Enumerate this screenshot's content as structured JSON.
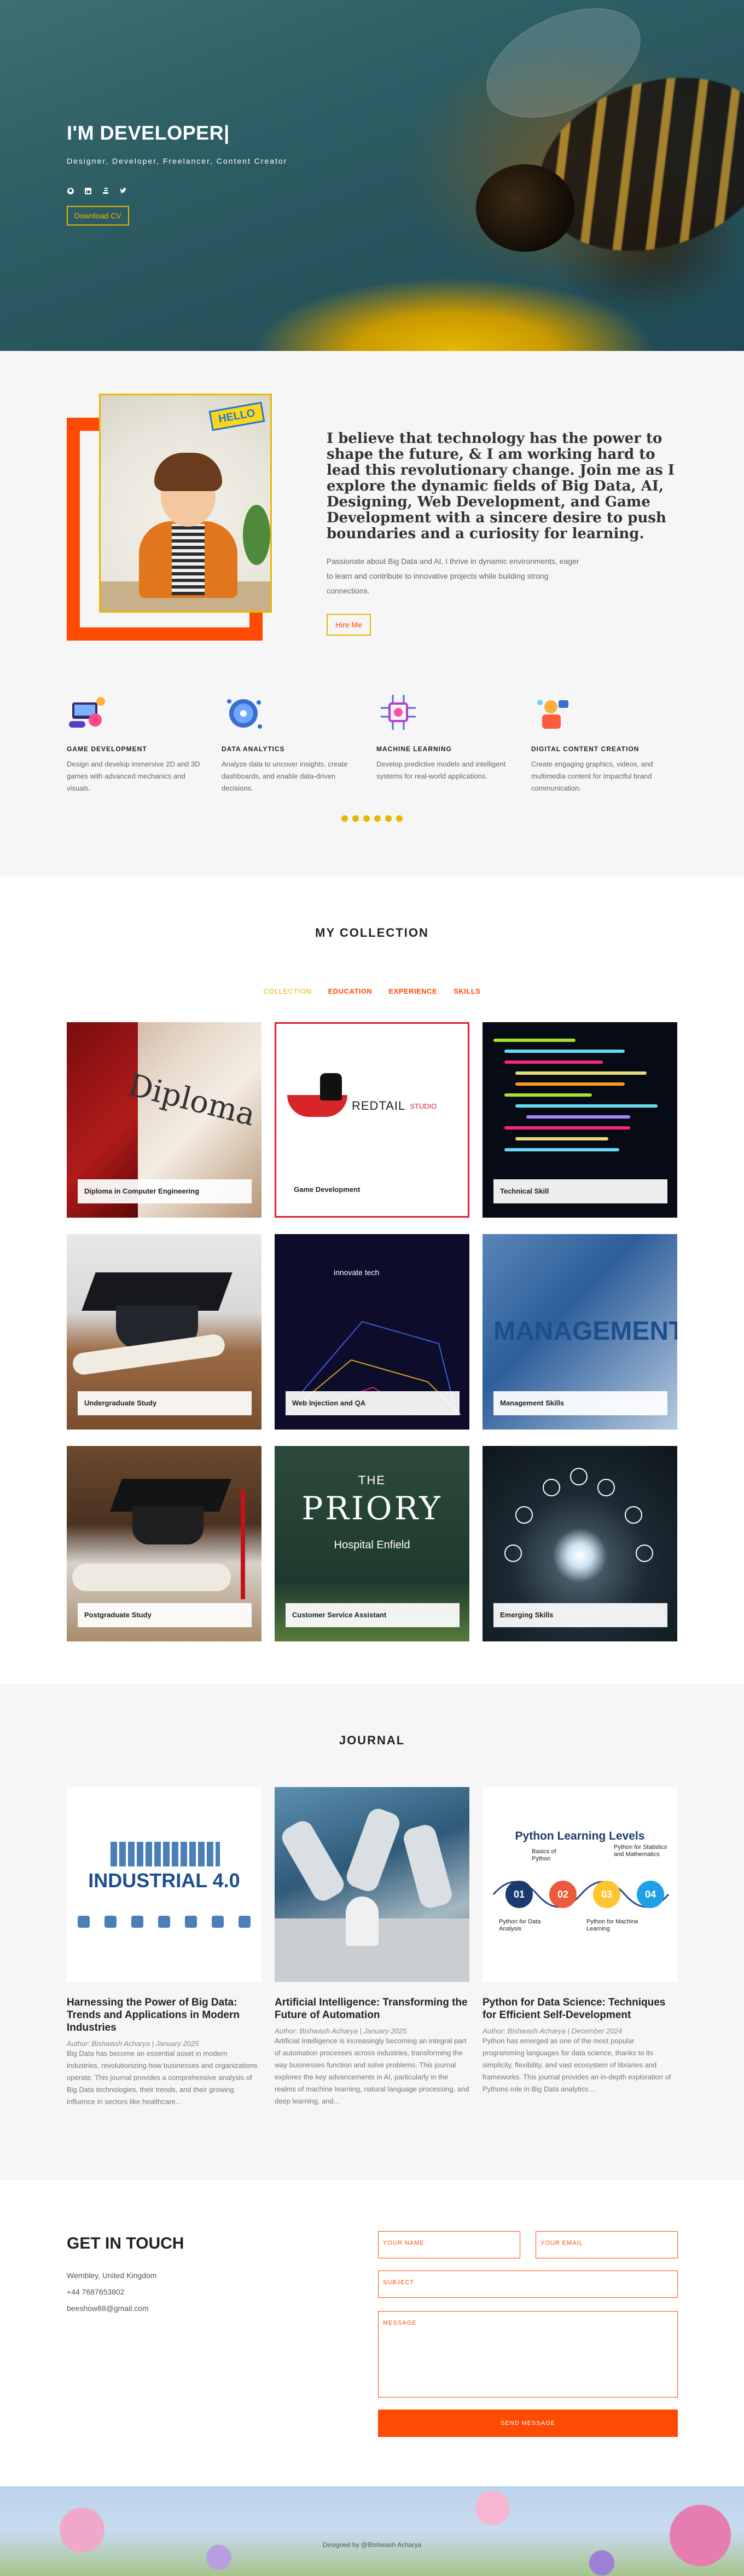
{
  "hero": {
    "title": "I'M DEVELOPER|",
    "subtitle": "Designer, Developer, Freelancer, Content Creator",
    "socials": [
      "github-icon",
      "linkedin-icon",
      "stack-icon",
      "twitter-icon"
    ],
    "cv_button": "Download CV"
  },
  "about": {
    "badge": "HELLO",
    "headline": "I believe that technology has the power to shape the future, & I am working hard to lead this revolutionary change. Join me as I explore the dynamic fields of Big Data, AI, Designing, Web Development, and Game Development with a sincere desire to push boundaries and a curiosity for learning.",
    "paragraph": "Passionate about Big Data and AI, I thrive in dynamic environments, eager to learn and contribute to innovative projects while building strong connections.",
    "hire_button": "Hire Me",
    "services": [
      {
        "icon": "game-development-icon",
        "title": "GAME DEVELOPMENT",
        "desc": "Design and develop immersive 2D and 3D games with advanced mechanics and visuals."
      },
      {
        "icon": "data-analytics-icon",
        "title": "DATA ANALYTICS",
        "desc": "Analyze data to uncover insights, create dashboards, and enable data-driven decisions."
      },
      {
        "icon": "machine-learning-icon",
        "title": "MACHINE LEARNING",
        "desc": "Develop predictive models and intelligent systems for real-world applications."
      },
      {
        "icon": "content-creation-icon",
        "title": "DIGITAL CONTENT CREATION",
        "desc": "Create engaging graphics, videos, and multimedia content for impactful brand communication."
      }
    ]
  },
  "collection": {
    "title": "MY COLLECTION",
    "filters": [
      "COLLECTION",
      "EDUCATION",
      "EXPERIENCE",
      "SKILLS"
    ],
    "items": [
      {
        "label": "Diploma in Computer Engineering",
        "image_text": "Diploma"
      },
      {
        "label": "Game Development",
        "brand": "REDTAIL",
        "brand_sub": "STUDIO"
      },
      {
        "label": "Technical Skill"
      },
      {
        "label": "Undergraduate Study"
      },
      {
        "label": "Web Injection and QA",
        "logo": "innovate tech"
      },
      {
        "label": "Management Skills",
        "image_text": "MANAGEMENT"
      },
      {
        "label": "Postgraduate Study"
      },
      {
        "label": "Customer Service Assistant",
        "the": "THE",
        "brand": "PRIORY",
        "brand_sub": "Hospital Enfield"
      },
      {
        "label": "Emerging Skills"
      }
    ]
  },
  "journal": {
    "title": "JOURNAL",
    "posts": [
      {
        "image_text": "INDUSTRIAL 4.0",
        "title": "Harnessing the Power of Big Data: Trends and Applications in Modern Industries",
        "author": "Author: Bishwash Acharya | January 2025",
        "excerpt": "Big Data has become an essential asset in modern industries, revolutionizing how businesses and organizations operate. This journal provides a comprehensive analysis of Big Data technologies, their trends, and their growing influence in sectors like healthcare..."
      },
      {
        "title": "Artificial Intelligence: Transforming the Future of Automation",
        "author": "Author: Bishwash Acharya | January 2025",
        "excerpt": "Artificial Intelligence is increasingly becoming an integral part of automation processes across industries, transforming the way businesses function and solve problems. This journal explores the key advancements in AI, particularly in the realms of machine learning, natural language processing, and deep learning, and..."
      },
      {
        "image_text": "Python Learning Levels",
        "steps": [
          "01",
          "02",
          "03",
          "04"
        ],
        "step_labels": [
          "Basics of Python",
          "Python for Data Analysis",
          "Python for Statistics and Mathematics",
          "Python for Machine Learning"
        ],
        "title": "Python for Data Science: Techniques for Efficient Self-Development",
        "author": "Author: Bishwash Acharya | December 2024",
        "excerpt": "Python has emerged as one of the most popular programming languages for data science, thanks to its simplicity, flexibility, and vast ecosystem of libraries and frameworks. This journal provides an in-depth exploration of Pythons role in Big Data analytics..."
      }
    ]
  },
  "contact": {
    "title": "GET IN TOUCH",
    "address": "Wembley, United Kingdom",
    "phone": "+44 7687653802",
    "email": "beeshow88@gmail.com",
    "name_placeholder": "YOUR NAME",
    "email_placeholder": "YOUR EMAIL",
    "subject_placeholder": "SUBJECT",
    "message_placeholder": "MESSAGE",
    "send_button": "SEND MESSAGE"
  },
  "footer": {
    "text": "Designed by @Bishwash Acharya"
  },
  "colors": {
    "accent": "#ff4a04",
    "gold": "#e6b800"
  }
}
